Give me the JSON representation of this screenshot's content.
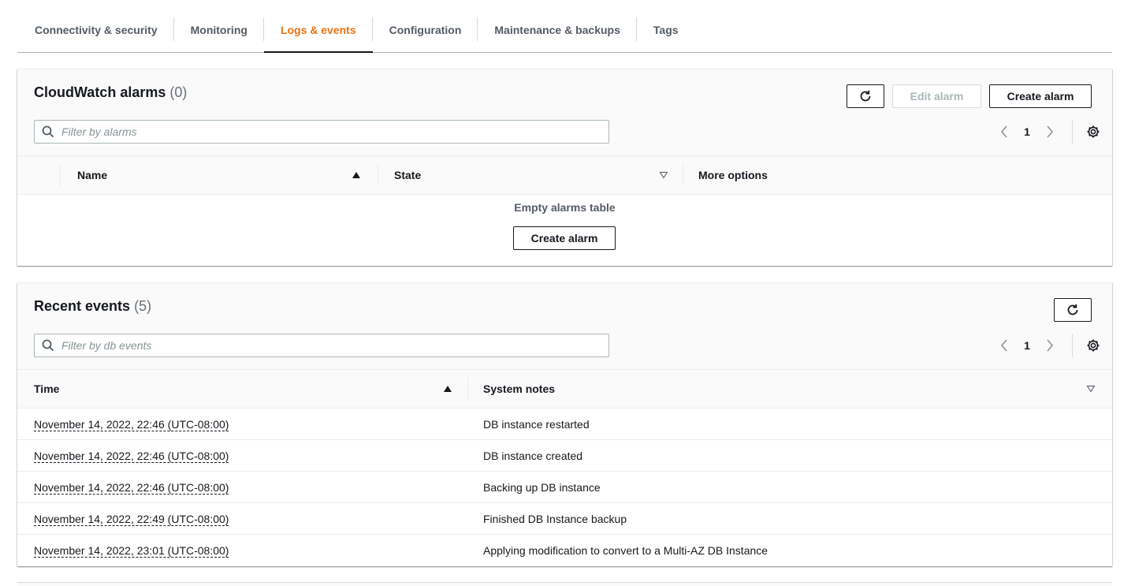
{
  "tabs": [
    {
      "label": "Connectivity & security",
      "active": false
    },
    {
      "label": "Monitoring",
      "active": false
    },
    {
      "label": "Logs & events",
      "active": true
    },
    {
      "label": "Configuration",
      "active": false
    },
    {
      "label": "Maintenance & backups",
      "active": false
    },
    {
      "label": "Tags",
      "active": false
    }
  ],
  "alarms": {
    "title": "CloudWatch alarms",
    "count": "(0)",
    "edit_label": "Edit alarm",
    "create_label": "Create alarm",
    "filter_placeholder": "Filter by alarms",
    "page": "1",
    "columns": {
      "name": "Name",
      "state": "State",
      "more": "More options"
    },
    "empty_title": "Empty alarms table",
    "empty_button": "Create alarm"
  },
  "events": {
    "title": "Recent events",
    "count": "(5)",
    "filter_placeholder": "Filter by db events",
    "page": "1",
    "columns": {
      "time": "Time",
      "notes": "System notes"
    },
    "rows": [
      {
        "time": "November 14, 2022, 22:46 (UTC-08:00)",
        "note": "DB instance restarted"
      },
      {
        "time": "November 14, 2022, 22:46 (UTC-08:00)",
        "note": "DB instance created"
      },
      {
        "time": "November 14, 2022, 22:46 (UTC-08:00)",
        "note": "Backing up DB instance"
      },
      {
        "time": "November 14, 2022, 22:49 (UTC-08:00)",
        "note": "Finished DB Instance backup"
      },
      {
        "time": "November 14, 2022, 23:01 (UTC-08:00)",
        "note": "Applying modification to convert to a Multi-AZ DB Instance"
      }
    ]
  },
  "colors": {
    "active_tab": "#ec7211",
    "text": "#16191f",
    "muted": "#545b64"
  },
  "icons": [
    "refresh-icon",
    "search-icon",
    "chevron-left-icon",
    "chevron-right-icon",
    "gear-icon",
    "sort-ascending-icon",
    "sort-descending-icon"
  ]
}
